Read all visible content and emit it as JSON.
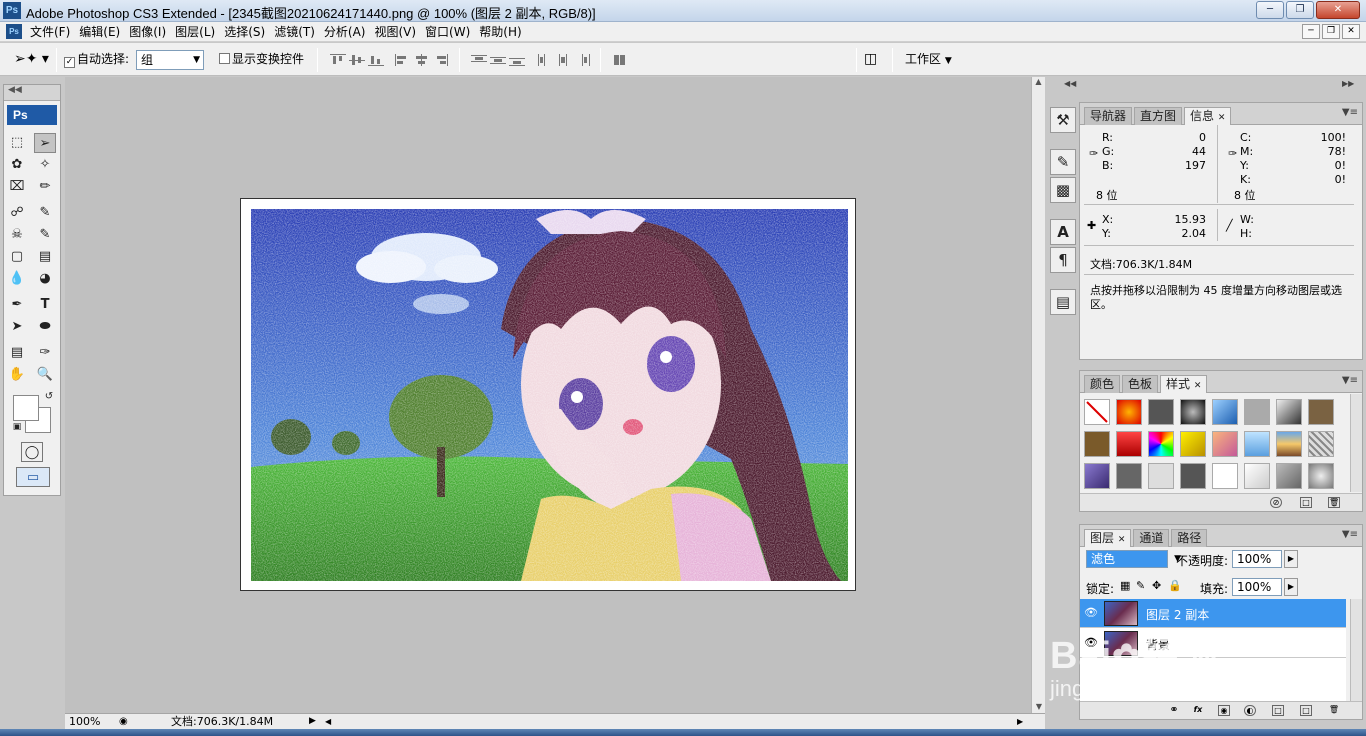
{
  "window": {
    "app_logo": "Ps",
    "title": "Adobe Photoshop CS3 Extended - [2345截图20210624171440.png @ 100% (图层 2 副本, RGB/8)]",
    "controls": [
      "minimize-icon",
      "restore-icon",
      "close-icon"
    ]
  },
  "menubar": {
    "logo": "Ps",
    "items": [
      "文件(F)",
      "编辑(E)",
      "图像(I)",
      "图层(L)",
      "选择(S)",
      "滤镜(T)",
      "分析(A)",
      "视图(V)",
      "窗口(W)",
      "帮助(H)"
    ]
  },
  "options": {
    "auto_select_label": "自动选择:",
    "auto_select_value": "组",
    "show_transform_label": "显示变换控件",
    "workspace_label": "工作区"
  },
  "toolbox": {
    "logo": "Ps"
  },
  "status": {
    "zoom": "100%",
    "doc_size": "文档:706.3K/1.84M"
  },
  "info_panel": {
    "tabs": [
      "导航器",
      "直方图",
      "信息"
    ],
    "active_tab": "信息",
    "rgb": {
      "r_label": "R:",
      "r": "0",
      "g_label": "G:",
      "g": "44",
      "b_label": "B:",
      "b": "197",
      "depth": "8 位"
    },
    "cmyk": {
      "c_label": "C:",
      "c": "100!",
      "m_label": "M:",
      "m": "78!",
      "y_label": "Y:",
      "y": "0!",
      "k_label": "K:",
      "k": "0!",
      "depth": "8 位"
    },
    "xy": {
      "x_label": "X:",
      "x": "15.93",
      "y_label": "Y:",
      "y": "2.04"
    },
    "wh": {
      "w_label": "W:",
      "h_label": "H:"
    },
    "doc": "文档:706.3K/1.84M",
    "hint": "点按并拖移以沿限制为 45 度增量方向移动图层或选区。"
  },
  "styles_panel": {
    "tabs": [
      "颜色",
      "色板",
      "样式"
    ],
    "active_tab": "样式"
  },
  "layers_panel": {
    "tabs": [
      "图层",
      "通道",
      "路径"
    ],
    "active_tab": "图层",
    "blend_mode": "滤色",
    "opacity_label": "不透明度:",
    "opacity": "100%",
    "lock_label": "锁定:",
    "fill_label": "填充:",
    "fill": "100%",
    "layers": [
      {
        "name": "图层 2 副本",
        "selected": true
      },
      {
        "name": "背景",
        "selected": false
      }
    ]
  },
  "watermark": {
    "brand": "Bai",
    "brand2": "经验",
    "url": "jingyan.baidu.com"
  },
  "colors": {
    "selection": "#3d96ee",
    "ps_blue": "#1f5aa6"
  }
}
